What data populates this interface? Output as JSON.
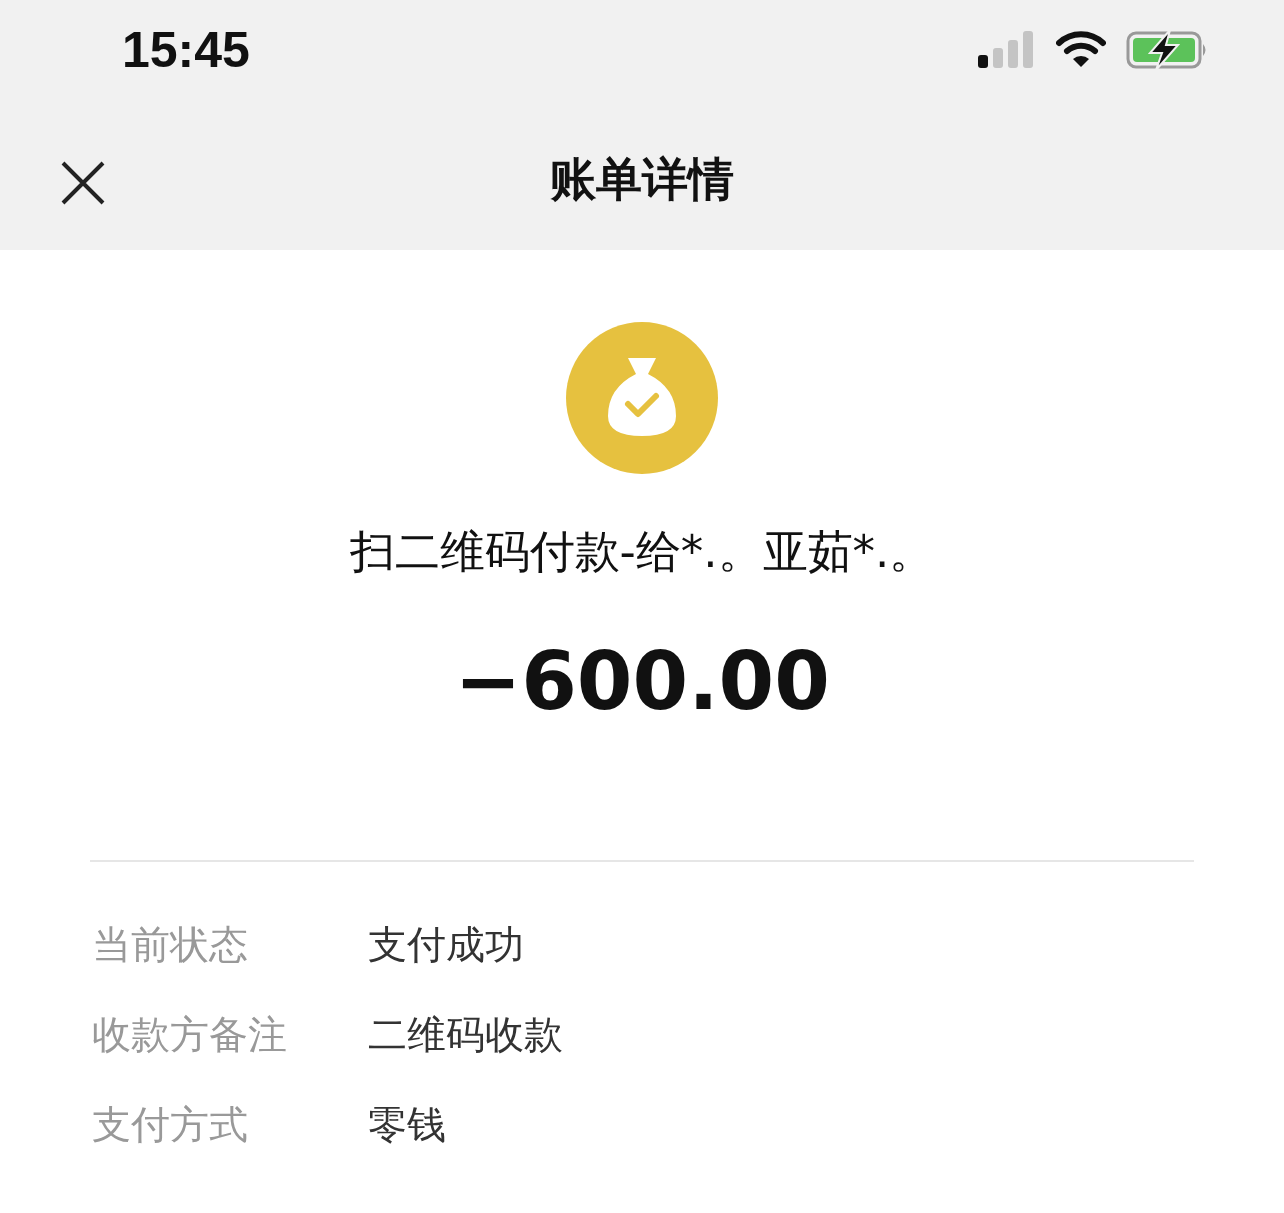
{
  "status_bar": {
    "time": "15:45"
  },
  "header": {
    "title": "账单详情"
  },
  "transaction": {
    "description": "扫二维码付款-给*.。亚茹*.。",
    "amount": "−600.00"
  },
  "details": [
    {
      "label": "当前状态",
      "value": "支付成功"
    },
    {
      "label": "收款方备注",
      "value": "二维码收款"
    },
    {
      "label": "支付方式",
      "value": "零钱"
    }
  ]
}
